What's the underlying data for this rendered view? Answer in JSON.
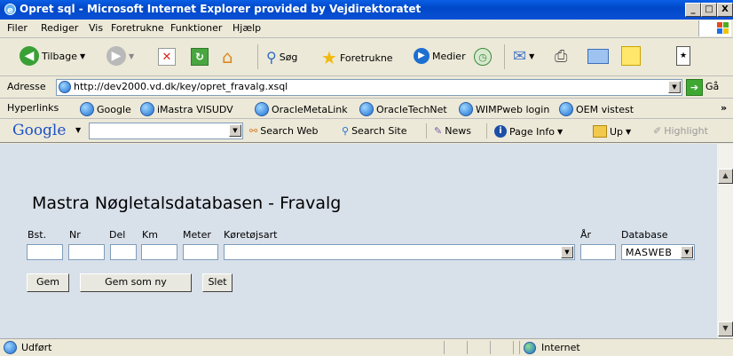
{
  "window": {
    "title": "Opret sql - Microsoft Internet Explorer provided by Vejdirektoratet",
    "minimize": "_",
    "maximize": "□",
    "close": "X"
  },
  "menu": [
    "Filer",
    "Rediger",
    "Vis",
    "Foretrukne",
    "Funktioner",
    "Hjælp"
  ],
  "toolbar": {
    "back": "Tilbage",
    "search": "Søg",
    "favorites": "Foretrukne",
    "media": "Medier"
  },
  "address": {
    "label": "Adresse",
    "url": "http://dev2000.vd.dk/key/opret_fravalg.xsql",
    "go": "Gå"
  },
  "links": {
    "label": "Hyperlinks",
    "items": [
      "Google",
      "iMastra VISUDV",
      "OracleMetaLink",
      "OracleTechNet",
      "WIMPweb login",
      "OEM vistest"
    ],
    "more": "»"
  },
  "googlebar": {
    "logo": "Google",
    "search_web": "Search Web",
    "search_site": "Search Site",
    "news": "News",
    "page_info": "Page Info",
    "up": "Up",
    "highlight": "Highlight"
  },
  "page": {
    "title": "Mastra Nøgletalsdatabasen - Fravalg",
    "labels": {
      "bst": "Bst.",
      "nr": "Nr",
      "del": "Del",
      "km": "Km",
      "meter": "Meter",
      "koretojsart": "Køretøjsart",
      "ar": "År",
      "database": "Database"
    },
    "values": {
      "bst": "",
      "nr": "",
      "del": "",
      "km": "",
      "meter": "",
      "koretojsart": "",
      "ar": "",
      "database": "MASWEB"
    },
    "buttons": {
      "gem": "Gem",
      "gem_som_ny": "Gem som ny",
      "slet": "Slet"
    }
  },
  "status": {
    "text": "Udført",
    "zone": "Internet"
  },
  "colors": {
    "titlebar": "#0A50D6",
    "content_bg": "#D8E0EA",
    "chrome": "#ECE9D8"
  }
}
